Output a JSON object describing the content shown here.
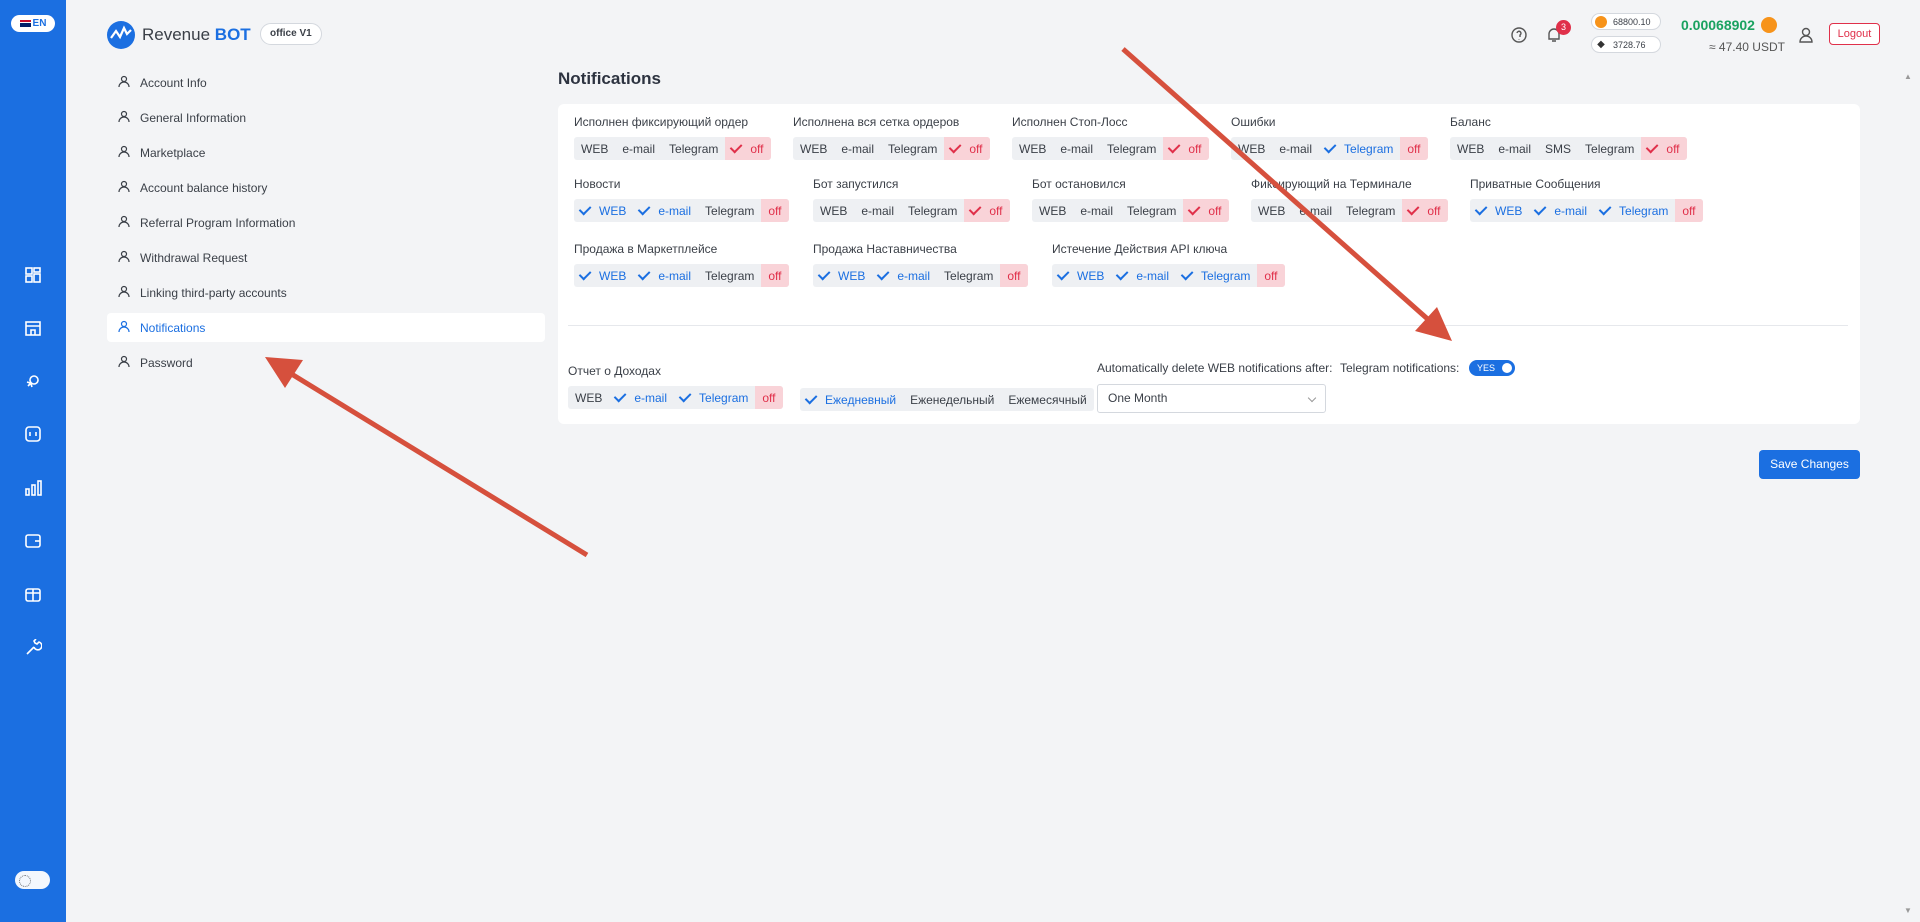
{
  "lang": "EN",
  "brand": {
    "name_regular": "Revenue",
    "name_bold": "BOT",
    "office": "office V1"
  },
  "header": {
    "notifications_count": "3",
    "btc_price": "68800.10",
    "eth_price": "3728.76",
    "balance_btc": "0.00068902",
    "balance_usdt": "≈ 47.40 USDT",
    "logout": "Logout"
  },
  "menu": [
    {
      "label": "Account Info",
      "icon": "user-icon"
    },
    {
      "label": "General Information",
      "icon": "user-info-icon"
    },
    {
      "label": "Marketplace",
      "icon": "store-icon"
    },
    {
      "label": "Account balance history",
      "icon": "history-icon"
    },
    {
      "label": "Referral Program Information",
      "icon": "referral-icon"
    },
    {
      "label": "Withdrawal Request",
      "icon": "document-icon"
    },
    {
      "label": "Linking third-party accounts",
      "icon": "link-icon"
    },
    {
      "label": "Notifications",
      "icon": "bell-icon",
      "active": true
    },
    {
      "label": "Password",
      "icon": "password-icon"
    }
  ],
  "page": {
    "title": "Notifications"
  },
  "groups": [
    {
      "label": "Исполнен фиксирующий ордер",
      "options": [
        [
          "WEB",
          false
        ],
        [
          "e-mail",
          false
        ],
        [
          "Telegram",
          false
        ]
      ],
      "off": "off",
      "off_checked": true
    },
    {
      "label": "Исполнена вся сетка ордеров",
      "options": [
        [
          "WEB",
          false
        ],
        [
          "e-mail",
          false
        ],
        [
          "Telegram",
          false
        ]
      ],
      "off": "off",
      "off_checked": true
    },
    {
      "label": "Исполнен Стоп-Лосс",
      "options": [
        [
          "WEB",
          false
        ],
        [
          "e-mail",
          false
        ],
        [
          "Telegram",
          false
        ]
      ],
      "off": "off",
      "off_checked": true
    },
    {
      "label": "Ошибки",
      "options": [
        [
          "WEB",
          false
        ],
        [
          "e-mail",
          false
        ],
        [
          "Telegram",
          true
        ]
      ],
      "off": "off",
      "off_checked": false
    },
    {
      "label": "Баланс",
      "options": [
        [
          "WEB",
          false
        ],
        [
          "e-mail",
          false
        ],
        [
          "SMS",
          false
        ],
        [
          "Telegram",
          false
        ]
      ],
      "off": "off",
      "off_checked": true
    },
    {
      "label": "Новости",
      "options": [
        [
          "WEB",
          true
        ],
        [
          "e-mail",
          true
        ],
        [
          "Telegram",
          false
        ]
      ],
      "off": "off",
      "off_checked": false
    },
    {
      "label": "Бот запустился",
      "options": [
        [
          "WEB",
          false
        ],
        [
          "e-mail",
          false
        ],
        [
          "Telegram",
          false
        ]
      ],
      "off": "off",
      "off_checked": true
    },
    {
      "label": "Бот остановился",
      "options": [
        [
          "WEB",
          false
        ],
        [
          "e-mail",
          false
        ],
        [
          "Telegram",
          false
        ]
      ],
      "off": "off",
      "off_checked": true
    },
    {
      "label": "Фиксирующий на Терминале",
      "options": [
        [
          "WEB",
          false
        ],
        [
          "e-mail",
          false
        ],
        [
          "Telegram",
          false
        ]
      ],
      "off": "off",
      "off_checked": true
    },
    {
      "label": "Приватные Сообщения",
      "options": [
        [
          "WEB",
          true
        ],
        [
          "e-mail",
          true
        ],
        [
          "Telegram",
          true
        ]
      ],
      "off": "off",
      "off_checked": false
    },
    {
      "label": "Продажа в Маркетплейсе",
      "options": [
        [
          "WEB",
          true
        ],
        [
          "e-mail",
          true
        ],
        [
          "Telegram",
          false
        ]
      ],
      "off": "off",
      "off_checked": false
    },
    {
      "label": "Продажа Наставничества",
      "options": [
        [
          "WEB",
          true
        ],
        [
          "e-mail",
          true
        ],
        [
          "Telegram",
          false
        ]
      ],
      "off": "off",
      "off_checked": false
    },
    {
      "label": "Истечение Действия API ключа",
      "options": [
        [
          "WEB",
          true
        ],
        [
          "e-mail",
          true
        ],
        [
          "Telegram",
          true
        ]
      ],
      "off": "off",
      "off_checked": false
    },
    {
      "label": "Отчет о Доходах",
      "options": [
        [
          "WEB",
          false
        ],
        [
          "e-mail",
          true
        ],
        [
          "Telegram",
          true
        ]
      ],
      "off": "off",
      "off_checked": false
    }
  ],
  "frequency": [
    [
      "Ежедневный",
      true
    ],
    [
      "Еженедельный",
      false
    ],
    [
      "Ежемесячный",
      false
    ]
  ],
  "auto_delete": {
    "label": "Automatically delete WEB notifications after:",
    "value": "One Month"
  },
  "telegram": {
    "label": "Telegram notifications:",
    "toggle": "YES"
  },
  "save": "Save Changes"
}
